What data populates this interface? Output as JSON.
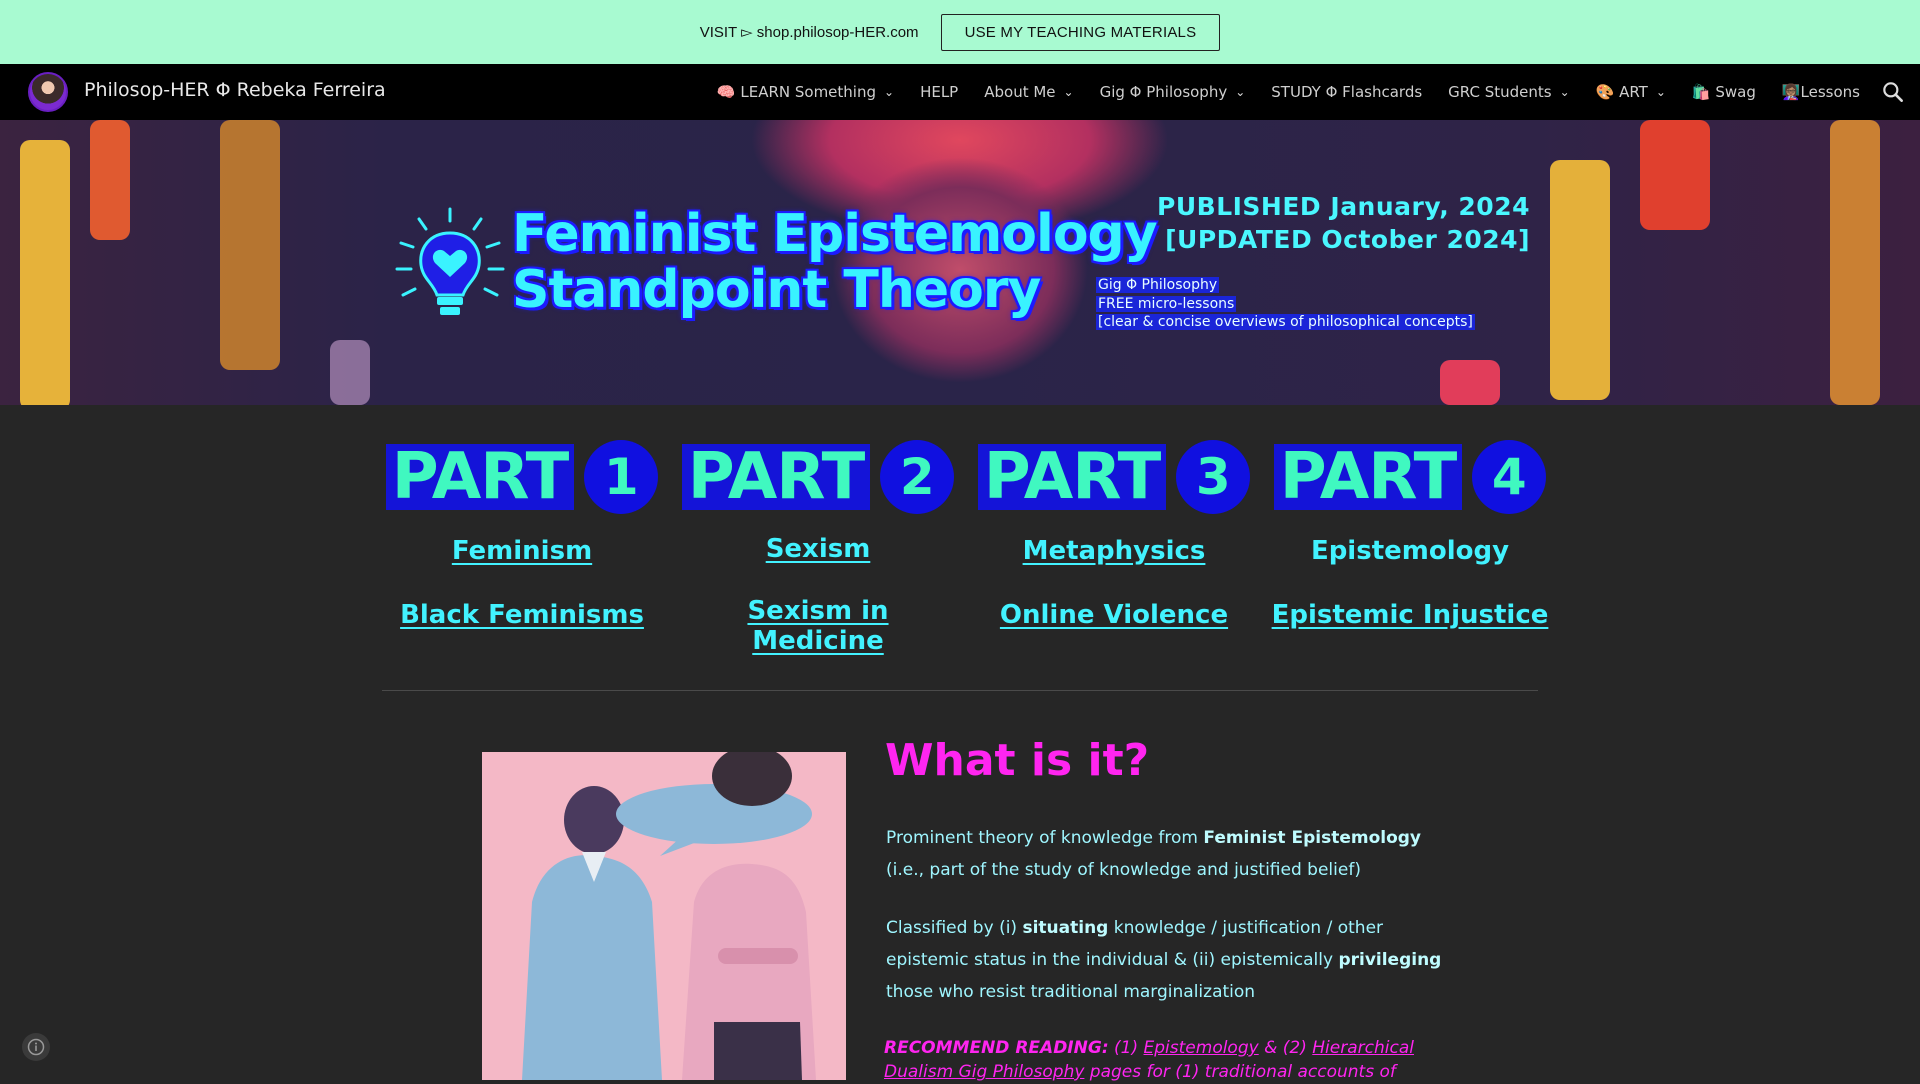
{
  "announcement": {
    "text": "VISIT ▻ shop.philosop-HER.com",
    "button_label": "USE MY TEACHING MATERIALS"
  },
  "nav": {
    "site_title": "Philosop-HER Φ Rebeka Ferreira",
    "items": [
      {
        "label": "🧠 LEARN Something",
        "dropdown": true
      },
      {
        "label": "HELP",
        "dropdown": false
      },
      {
        "label": "About Me",
        "dropdown": true
      },
      {
        "label": "Gig Φ Philosophy",
        "dropdown": true
      },
      {
        "label": "STUDY Φ Flashcards",
        "dropdown": false
      },
      {
        "label": "GRC Students",
        "dropdown": true
      },
      {
        "label": "🎨 ART",
        "dropdown": true
      },
      {
        "label": "🛍️ Swag",
        "dropdown": false
      },
      {
        "label": "👩🏽‍🏫Lessons",
        "dropdown": false
      }
    ]
  },
  "banner": {
    "title_line1": "Feminist Epistemology",
    "title_line2": "Standpoint Theory",
    "published_line1": "PUBLISHED January, 2024",
    "published_line2": "[UPDATED October 2024]",
    "micro_line1": "Gig Φ Philosophy",
    "micro_line2": "FREE micro-lessons",
    "micro_line3": "[clear & concise overviews of philosophical concepts]"
  },
  "parts": [
    {
      "word": "PART",
      "num": "1",
      "link1": "Feminism",
      "link2": "Black Feminisms",
      "link1_underlined": true
    },
    {
      "word": "PART",
      "num": "2",
      "link1": "Sexism",
      "link2": "Sexism in Medicine",
      "link1_underlined": true
    },
    {
      "word": "PART",
      "num": "3",
      "link1": "Metaphysics",
      "link2": "Online Violence",
      "link1_underlined": true
    },
    {
      "word": "PART",
      "num": "4",
      "link1": "Epistemology",
      "link2": "Epistemic Injustice",
      "link1_underlined": false
    }
  ],
  "article": {
    "heading": "What is it?",
    "p1_pre": "Prominent theory of knowledge from ",
    "p1_bold": "Feminist Epistemology",
    "p1_post": "(i.e., part of the study of knowledge and justified belief)",
    "p2_pre": "Classified by (i) ",
    "p2_bold1": "situating",
    "p2_mid": " knowledge / justification / other epistemic status in the individual & (ii) epistemically ",
    "p2_bold2": "privileging",
    "p2_post": " those who resist traditional marginalization",
    "rec_label": "RECOMMEND READING:",
    "rec_1": " (1) ",
    "rec_link1": "Epistemology",
    "rec_2": " & (2) ",
    "rec_link2": "Hierarchical",
    "rec_line2_link": "Dualism Gig Philosophy",
    "rec_line2_rest": " pages for (1) traditional accounts of"
  },
  "colors": {
    "announcement_bg": "#a8fad1",
    "nav_bg": "#000000",
    "page_bg": "#262626",
    "accent_cyan": "#42f2ff",
    "accent_magenta": "#ff25f0",
    "part_blue": "#1414d8",
    "part_green": "#40f8c0"
  },
  "icons": {
    "search": "search-icon",
    "info": "info-icon",
    "bulb": "lightbulb-heart-icon",
    "chevron": "chevron-down-icon"
  }
}
